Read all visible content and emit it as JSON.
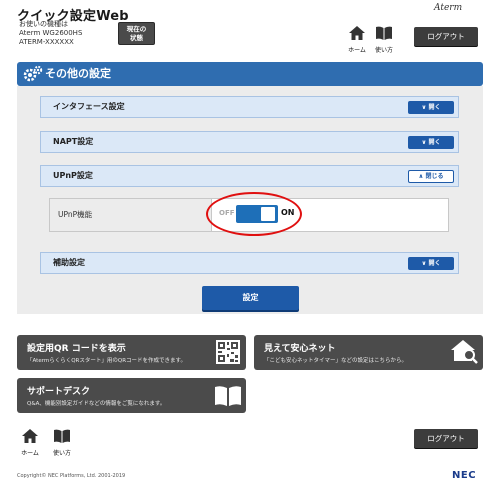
{
  "header": {
    "title": "クイック設定Web",
    "sub_line1": "お使いの機種は",
    "sub_line2": "Aterm WG2600HS",
    "sub_line3": "ATERM-XXXXXX",
    "status_line1": "現在の",
    "status_line2": "状態",
    "brand": "Aterm",
    "home_label": "ホーム",
    "howto_label": "使い方",
    "logout_label": "ログアウト"
  },
  "section": {
    "title": "その他の設定"
  },
  "accordions": [
    {
      "label": "インタフェース設定",
      "button": "開く",
      "state": "closed"
    },
    {
      "label": "NAPT設定",
      "button": "開く",
      "state": "closed"
    },
    {
      "label": "UPnP設定",
      "button": "閉じる",
      "state": "open"
    },
    {
      "label": "補助設定",
      "button": "開く",
      "state": "closed"
    }
  ],
  "upnp": {
    "label": "UPnP機能",
    "off_label": "OFF",
    "on_label": "ON",
    "value": "ON"
  },
  "save_label": "設定",
  "cards": {
    "qr": {
      "title": "設定用QR コードを表示",
      "sub": "「AtermらくらくQRスタート」用のQRコードを作成できます。",
      "icon": "qr-code-icon"
    },
    "safety": {
      "title": "見えて安心ネット",
      "sub": "「こども安心ネットタイマー」などの設定はこちらから。",
      "icon": "home-search-icon"
    },
    "support": {
      "title": "サポートデスク",
      "sub": "Q&A、機能別設定ガイドなどの情報をご覧になれます。",
      "icon": "book-icon"
    }
  },
  "footer": {
    "home_label": "ホーム",
    "howto_label": "使い方",
    "logout_label": "ログアウト",
    "copyright": "Copyright© NEC Platforms, Ltd. 2001-2019",
    "logo": "NEC"
  },
  "colors": {
    "accent": "#2f6db0",
    "button_blue": "#1e5aa8",
    "dark": "#4b4b4b",
    "highlight_ring": "#e01010"
  }
}
